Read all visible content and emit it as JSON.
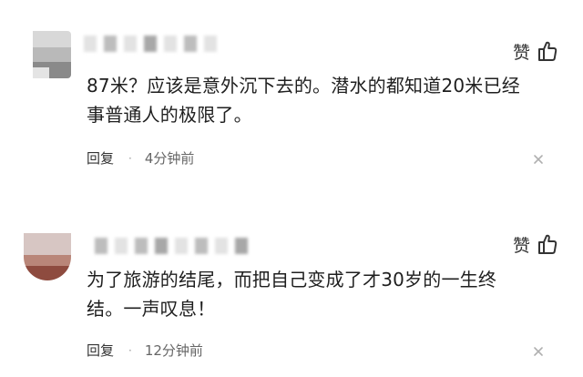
{
  "comments": [
    {
      "like_label": "赞",
      "text": "87米？应该是意外沉下去的。潜水的都知道20米已经\n事普通人的极限了。",
      "reply_label": "回复",
      "separator": "·",
      "time": "4分钟前",
      "avatar_icon": "avatar-icon",
      "like_icon": "thumbs-up-icon",
      "close_icon": "close-icon"
    },
    {
      "like_label": "赞",
      "text": "为了旅游的结尾，而把自己变成了才30岁的一生终\n结。一声叹息！",
      "reply_label": "回复",
      "separator": "·",
      "time": "12分钟前",
      "avatar_icon": "avatar-icon",
      "like_icon": "thumbs-up-icon",
      "close_icon": "close-icon"
    }
  ],
  "colors": {
    "text": "#1f1f1f",
    "meta": "#666666",
    "close": "#b0b0b0"
  }
}
